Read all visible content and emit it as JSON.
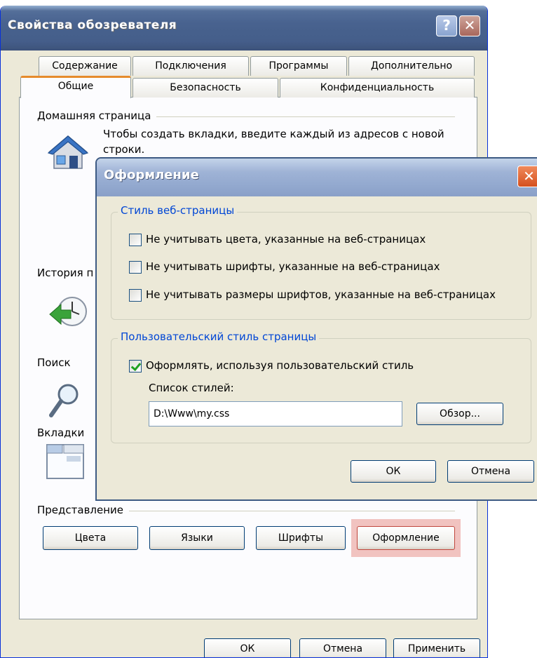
{
  "main_window": {
    "title": "Свойства обозревателя",
    "help_symbol": "?",
    "close_symbol": "✕",
    "tabs_row1": [
      "Содержание",
      "Подключения",
      "Программы",
      "Дополнительно"
    ],
    "tabs_row2": [
      "Общие",
      "Безопасность",
      "Конфиденциальность"
    ],
    "homepage": {
      "label": "Домашняя страница",
      "hint": "Чтобы создать вкладки, введите каждый из адресов с новой строки."
    },
    "history": {
      "label": "История п"
    },
    "search": {
      "label": "Поиск"
    },
    "tabs_section": {
      "label": "Вкладки"
    },
    "appearance": {
      "label": "Представление",
      "buttons": [
        "Цвета",
        "Языки",
        "Шрифты",
        "Оформление"
      ]
    },
    "footer_buttons": {
      "ok": "ОК",
      "cancel": "Отмена",
      "apply": "Применить"
    }
  },
  "dialog": {
    "title": "Оформление",
    "close_symbol": "✕",
    "page_style_group": {
      "legend": "Стиль веб-страницы",
      "options": [
        {
          "label": "Не учитывать цвета, указанные на веб-страницах",
          "checked": false
        },
        {
          "label": "Не учитывать шрифты, указанные на веб-страницах",
          "checked": false
        },
        {
          "label": "Не учитывать размеры шрифтов, указанные на веб-страницах",
          "checked": false
        }
      ]
    },
    "user_style_group": {
      "legend": "Пользовательский стиль страницы",
      "option": {
        "label": "Оформлять, используя пользовательский стиль",
        "checked": true
      },
      "list_label": "Список стилей:",
      "style_path": "D:\\Www\\my.css",
      "browse_button": "Обзор..."
    },
    "ok_button": "ОК",
    "cancel_button": "Отмена"
  },
  "colors": {
    "highlight": "#f1c3c0",
    "legend_text": "#0046d5",
    "tab_accent": "#e68b2c"
  }
}
